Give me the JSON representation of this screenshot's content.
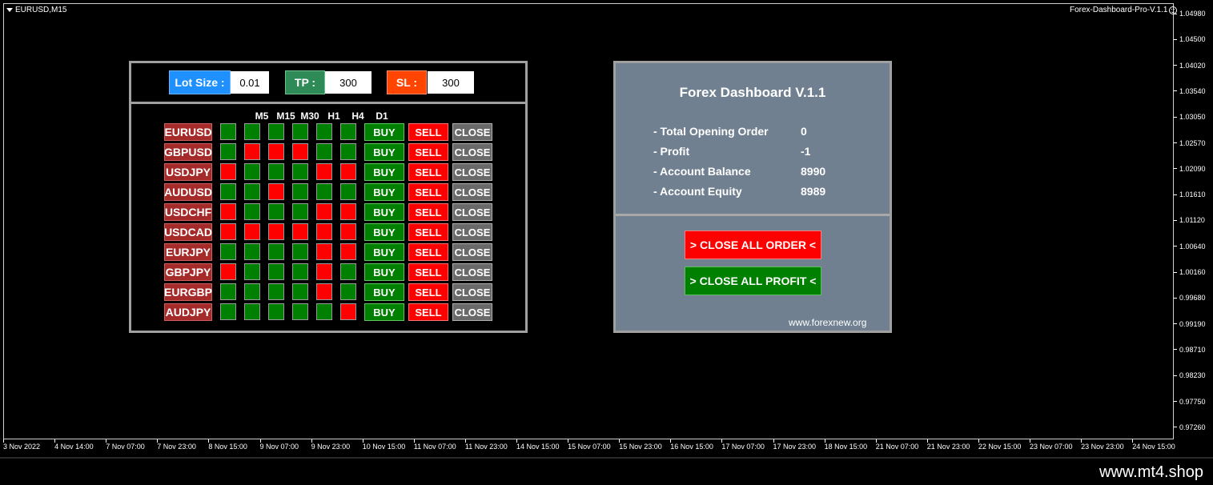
{
  "chart": {
    "symbol": "EURUSD,M15",
    "ea_name": "Forex-Dashboard-Pro-V.1.1",
    "prices": [
      "1.04980",
      "1.04500",
      "1.04020",
      "1.03540",
      "1.03050",
      "1.02570",
      "1.02090",
      "1.01610",
      "1.01120",
      "1.00640",
      "1.00160",
      "0.99680",
      "0.99190",
      "0.98710",
      "0.98230",
      "0.97750",
      "0.97260"
    ],
    "times": [
      "3 Nov 2022",
      "4 Nov 14:00",
      "7 Nov 07:00",
      "7 Nov 23:00",
      "8 Nov 15:00",
      "9 Nov 07:00",
      "9 Nov 23:00",
      "10 Nov 15:00",
      "11 Nov 07:00",
      "11 Nov 23:00",
      "14 Nov 15:00",
      "15 Nov 07:00",
      "15 Nov 23:00",
      "16 Nov 15:00",
      "17 Nov 07:00",
      "17 Nov 23:00",
      "18 Nov 15:00",
      "21 Nov 07:00",
      "21 Nov 23:00",
      "22 Nov 15:00",
      "23 Nov 07:00",
      "23 Nov 23:00",
      "24 Nov 15:00"
    ]
  },
  "controls": {
    "lot_label": "Lot Size :",
    "lot_value": "0.01",
    "tp_label": "TP :",
    "tp_value": "300",
    "sl_label": "SL :",
    "sl_value": "300"
  },
  "timeframes": [
    "M5",
    "M15",
    "M30",
    "H1",
    "H4",
    "D1"
  ],
  "actions": {
    "buy": "BUY",
    "sell": "SELL",
    "close": "CLOSE"
  },
  "pairs": [
    {
      "name": "EURUSD",
      "signals": [
        "g",
        "g",
        "g",
        "g",
        "g",
        "g"
      ]
    },
    {
      "name": "GBPUSD",
      "signals": [
        "g",
        "r",
        "r",
        "r",
        "g",
        "g"
      ]
    },
    {
      "name": "USDJPY",
      "signals": [
        "r",
        "g",
        "g",
        "g",
        "r",
        "r"
      ]
    },
    {
      "name": "AUDUSD",
      "signals": [
        "g",
        "g",
        "r",
        "g",
        "g",
        "g"
      ]
    },
    {
      "name": "USDCHF",
      "signals": [
        "r",
        "g",
        "g",
        "g",
        "r",
        "r"
      ]
    },
    {
      "name": "USDCAD",
      "signals": [
        "r",
        "r",
        "r",
        "r",
        "r",
        "r"
      ]
    },
    {
      "name": "EURJPY",
      "signals": [
        "g",
        "g",
        "g",
        "g",
        "r",
        "r"
      ]
    },
    {
      "name": "GBPJPY",
      "signals": [
        "r",
        "g",
        "g",
        "g",
        "r",
        "g"
      ]
    },
    {
      "name": "EURGBP",
      "signals": [
        "g",
        "g",
        "g",
        "g",
        "r",
        "g"
      ]
    },
    {
      "name": "AUDJPY",
      "signals": [
        "g",
        "g",
        "g",
        "g",
        "g",
        "r"
      ]
    }
  ],
  "dashboard": {
    "title": "Forex Dashboard V.1.1",
    "stats": [
      {
        "label": "- Total Opening Order",
        "value": "0"
      },
      {
        "label": "- Profit",
        "value": "-1"
      },
      {
        "label": "- Account Balance",
        "value": "8990"
      },
      {
        "label": "- Account Equity",
        "value": "8989"
      }
    ],
    "close_all_order": "> CLOSE ALL ORDER <",
    "close_all_profit": "> CLOSE ALL PROFIT <",
    "site": "www.forexnew.org"
  },
  "footer": {
    "site": "www.mt4.shop"
  },
  "colors": {
    "green": "#008000",
    "red": "#ff0000",
    "panel": "#708090",
    "lot": "#1e90ff",
    "tp": "#2e8b57",
    "sl": "#ff4500"
  }
}
